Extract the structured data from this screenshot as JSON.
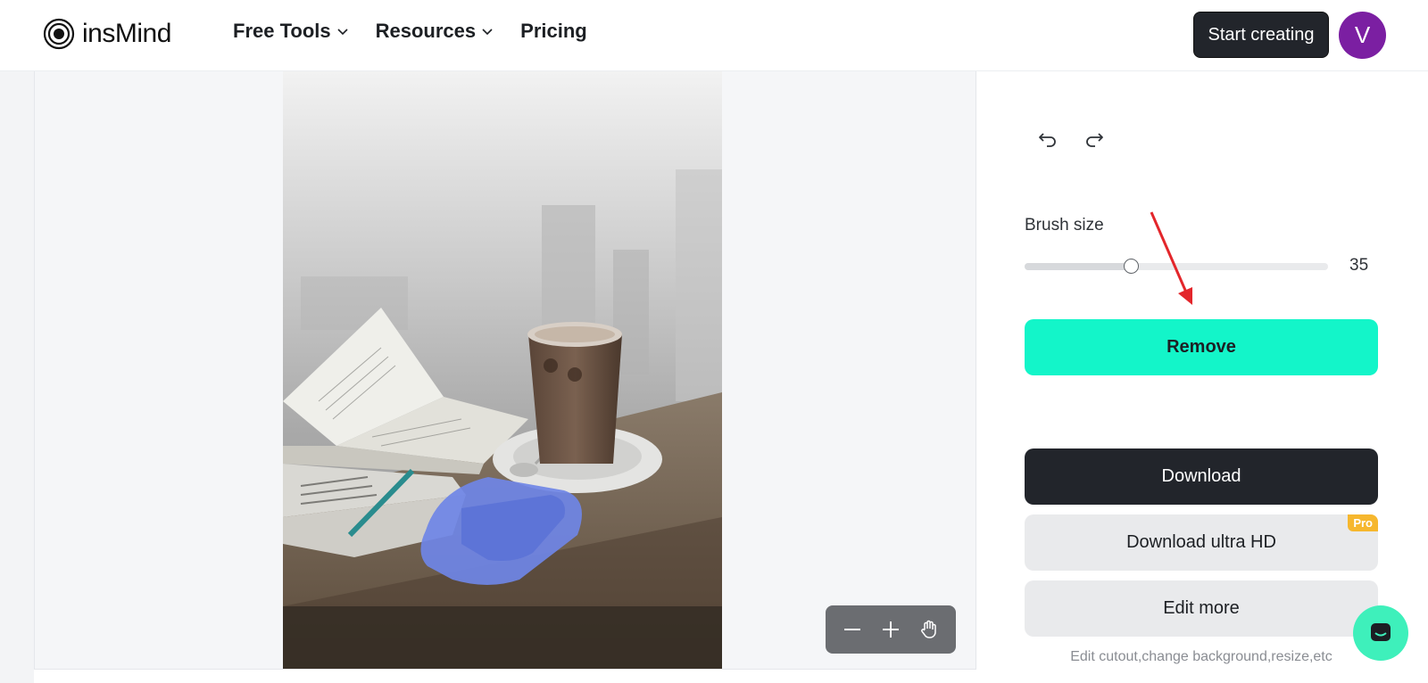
{
  "header": {
    "logo_text": "insMind",
    "nav": [
      {
        "label": "Free Tools",
        "has_dropdown": true
      },
      {
        "label": "Resources",
        "has_dropdown": true
      },
      {
        "label": "Pricing",
        "has_dropdown": false
      }
    ],
    "start_button": "Start creating",
    "avatar_initial": "V",
    "avatar_color": "#7b1fa2"
  },
  "canvas": {
    "image_subject": "coffee-table-photo",
    "mask_color": "#6f86e6"
  },
  "panel": {
    "brush_label": "Brush size",
    "brush_value": "35",
    "brush_fraction": 0.35,
    "remove_label": "Remove",
    "remove_color": "#13f5c9",
    "download_label": "Download",
    "download_hd_label": "Download ultra HD",
    "pro_badge": "Pro",
    "edit_more_label": "Edit more",
    "edit_hint": "Edit cutout,change background,resize,etc"
  },
  "annotation_color": "#e3262b"
}
